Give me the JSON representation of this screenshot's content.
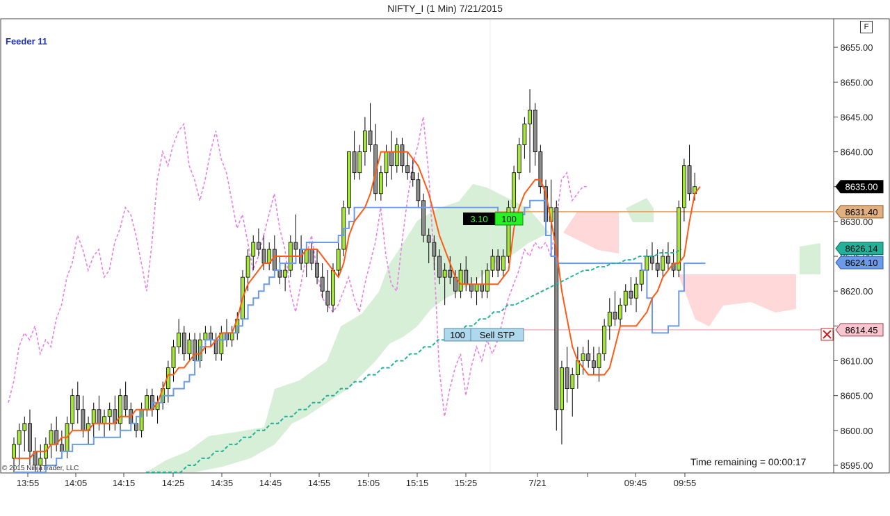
{
  "window": {
    "title": "NIFTY_I (1 Min)  7/21/2015"
  },
  "feeder": {
    "label": "Feeder 11"
  },
  "toolbar": {
    "f_button": "F"
  },
  "status": {
    "time_remaining": "Time remaining = 00:00:17",
    "copyright": "© 2015 NinjaTrader, LLC"
  },
  "orders": {
    "position": {
      "pnl": "3.10",
      "qty": "100"
    },
    "stop": {
      "qty": "100",
      "label": "Sell STP"
    }
  },
  "colors": {
    "candle_up": "#a6e63c",
    "candle_down": "#8c8c8c",
    "fast_line": "#ff5a14",
    "slow_line": "#6a9ae8",
    "dashed_teal": "#25b09b",
    "lagging_pink": "#e87ee8",
    "cloud_green": "#c9e8c9",
    "cloud_red": "#ffd0d0",
    "position_line": "#e8a060",
    "stop_line": "#f0b4c0"
  },
  "chart_data": {
    "type": "candlestick",
    "title": "NIFTY_I (1 Min)  7/21/2015",
    "ylim": [
      8594,
      8659
    ],
    "y_ticks": [
      8595,
      8600,
      8605,
      8610,
      8615,
      8620,
      8625,
      8630,
      8635,
      8640,
      8645,
      8650,
      8655
    ],
    "x_ticks": [
      "13:55",
      "14:05",
      "14:15",
      "14:25",
      "14:35",
      "14:45",
      "14:55",
      "15:05",
      "15:15",
      "15:25",
      "7/21",
      "09:45",
      "09:55"
    ],
    "price_markers": [
      {
        "label": "8635.00",
        "value": 8635.0,
        "kind": "last"
      },
      {
        "label": "8631.40",
        "value": 8631.4,
        "kind": "position"
      },
      {
        "label": "8626.14",
        "value": 8626.14,
        "kind": "teal"
      },
      {
        "label": "8624.10",
        "value": 8624.1,
        "kind": "slow"
      },
      {
        "label": "8614.45",
        "value": 8614.45,
        "kind": "stop"
      }
    ],
    "position_price": 8631.4,
    "stop_price": 8614.45,
    "candles": [
      [
        8596.0,
        8599.0,
        8594.0,
        8598.0
      ],
      [
        8598.0,
        8601.0,
        8595.0,
        8600.0
      ],
      [
        8600.0,
        8602.0,
        8597.0,
        8601.0
      ],
      [
        8601.0,
        8603.0,
        8595.0,
        8597.0
      ],
      [
        8597.0,
        8599.0,
        8594.0,
        8595.0
      ],
      [
        8595.0,
        8598.0,
        8594.0,
        8596.0
      ],
      [
        8596.0,
        8599.0,
        8595.0,
        8598.0
      ],
      [
        8598.0,
        8601.0,
        8596.0,
        8600.0
      ],
      [
        8600.0,
        8602.0,
        8597.0,
        8598.0
      ],
      [
        8598.0,
        8600.0,
        8596.0,
        8597.0
      ],
      [
        8597.0,
        8602.0,
        8596.0,
        8601.0
      ],
      [
        8601.0,
        8606.0,
        8600.0,
        8605.0
      ],
      [
        8605.0,
        8607.0,
        8601.0,
        8603.0
      ],
      [
        8603.0,
        8605.0,
        8599.0,
        8600.0
      ],
      [
        8600.0,
        8602.0,
        8598.0,
        8601.0
      ],
      [
        8601.0,
        8604.0,
        8599.0,
        8603.0
      ],
      [
        8603.0,
        8605.0,
        8600.0,
        8601.0
      ],
      [
        8601.0,
        8603.0,
        8599.0,
        8602.0
      ],
      [
        8602.0,
        8604.0,
        8600.0,
        8603.0
      ],
      [
        8603.0,
        8605.0,
        8600.0,
        8601.0
      ],
      [
        8601.0,
        8606.0,
        8600.0,
        8605.0
      ],
      [
        8605.0,
        8607.0,
        8602.0,
        8603.0
      ],
      [
        8603.0,
        8604.0,
        8600.0,
        8601.0
      ],
      [
        8601.0,
        8602.0,
        8599.0,
        8600.0
      ],
      [
        8600.0,
        8604.0,
        8599.0,
        8603.0
      ],
      [
        8603.0,
        8606.0,
        8602.0,
        8605.0
      ],
      [
        8605.0,
        8606.0,
        8602.0,
        8603.0
      ],
      [
        8603.0,
        8605.0,
        8601.0,
        8604.0
      ],
      [
        8604.0,
        8607.0,
        8603.0,
        8606.0
      ],
      [
        8606.0,
        8610.0,
        8604.0,
        8609.0
      ],
      [
        8609.0,
        8613.0,
        8607.0,
        8612.0
      ],
      [
        8612.0,
        8616.0,
        8611.0,
        8614.0
      ],
      [
        8614.0,
        8615.0,
        8610.0,
        8611.0
      ],
      [
        8611.0,
        8614.0,
        8610.0,
        8613.0
      ],
      [
        8613.0,
        8614.0,
        8609.0,
        8610.0
      ],
      [
        8610.0,
        8614.0,
        8609.0,
        8613.0
      ],
      [
        8613.0,
        8615.0,
        8611.0,
        8614.0
      ],
      [
        8614.0,
        8615.0,
        8612.0,
        8613.0
      ],
      [
        8613.0,
        8614.0,
        8610.0,
        8611.0
      ],
      [
        8611.0,
        8615.0,
        8610.0,
        8614.0
      ],
      [
        8614.0,
        8616.0,
        8612.0,
        8613.0
      ],
      [
        8613.0,
        8615.0,
        8612.0,
        8614.0
      ],
      [
        8614.0,
        8617.0,
        8613.0,
        8616.0
      ],
      [
        8616.0,
        8623.0,
        8615.0,
        8622.0
      ],
      [
        8622.0,
        8626.0,
        8620.0,
        8625.0
      ],
      [
        8625.0,
        8628.0,
        8623.0,
        8627.0
      ],
      [
        8627.0,
        8629.0,
        8625.0,
        8626.0
      ],
      [
        8626.0,
        8628.0,
        8623.0,
        8624.0
      ],
      [
        8624.0,
        8627.0,
        8623.0,
        8626.0
      ],
      [
        8626.0,
        8628.0,
        8622.0,
        8623.0
      ],
      [
        8623.0,
        8625.0,
        8621.0,
        8622.0
      ],
      [
        8622.0,
        8624.0,
        8620.0,
        8623.0
      ],
      [
        8623.0,
        8628.0,
        8622.0,
        8627.0
      ],
      [
        8627.0,
        8631.0,
        8625.0,
        8626.0
      ],
      [
        8626.0,
        8628.0,
        8623.0,
        8624.0
      ],
      [
        8624.0,
        8627.0,
        8622.0,
        8626.0
      ],
      [
        8626.0,
        8627.0,
        8623.0,
        8624.0
      ],
      [
        8624.0,
        8626.0,
        8621.0,
        8622.0
      ],
      [
        8622.0,
        8624.0,
        8619.0,
        8620.0
      ],
      [
        8620.0,
        8623.0,
        8617.0,
        8618.0
      ],
      [
        8618.0,
        8624.0,
        8617.0,
        8623.0
      ],
      [
        8623.0,
        8627.0,
        8622.0,
        8626.0
      ],
      [
        8626.0,
        8633.0,
        8625.0,
        8632.0
      ],
      [
        8632.0,
        8640.0,
        8631.0,
        8640.0
      ],
      [
        8640.0,
        8643.0,
        8636.0,
        8637.0
      ],
      [
        8637.0,
        8641.0,
        8636.0,
        8640.0
      ],
      [
        8640.0,
        8645.0,
        8638.0,
        8643.0
      ],
      [
        8643.0,
        8647.0,
        8640.0,
        8641.0
      ],
      [
        8641.0,
        8644.0,
        8633.0,
        8634.0
      ],
      [
        8634.0,
        8638.0,
        8633.0,
        8637.0
      ],
      [
        8637.0,
        8641.0,
        8635.0,
        8640.0
      ],
      [
        8640.0,
        8643.0,
        8636.0,
        8638.0
      ],
      [
        8638.0,
        8642.0,
        8637.0,
        8641.0
      ],
      [
        8641.0,
        8642.0,
        8637.0,
        8638.0
      ],
      [
        8638.0,
        8640.0,
        8636.0,
        8637.0
      ],
      [
        8637.0,
        8639.0,
        8635.0,
        8636.0
      ],
      [
        8636.0,
        8637.0,
        8632.0,
        8633.0
      ],
      [
        8633.0,
        8634.0,
        8627.0,
        8628.0
      ],
      [
        8628.0,
        8629.0,
        8624.0,
        8627.0
      ],
      [
        8627.0,
        8628.0,
        8623.0,
        8625.0
      ],
      [
        8625.0,
        8626.0,
        8621.0,
        8622.0
      ],
      [
        8622.0,
        8624.0,
        8618.0,
        8623.0
      ],
      [
        8623.0,
        8625.0,
        8621.0,
        8622.0
      ],
      [
        8622.0,
        8623.0,
        8619.0,
        8620.0
      ],
      [
        8620.0,
        8624.0,
        8619.0,
        8623.0
      ],
      [
        8623.0,
        8625.0,
        8620.0,
        8621.0
      ],
      [
        8621.0,
        8622.0,
        8619.0,
        8620.0
      ],
      [
        8620.0,
        8622.0,
        8618.0,
        8621.0
      ],
      [
        8621.0,
        8623.0,
        8619.0,
        8620.0
      ],
      [
        8620.0,
        8624.0,
        8619.0,
        8623.0
      ],
      [
        8623.0,
        8626.0,
        8622.0,
        8625.0
      ],
      [
        8625.0,
        8626.0,
        8622.0,
        8623.0
      ],
      [
        8623.0,
        8626.0,
        8622.0,
        8625.0
      ],
      [
        8625.0,
        8633.0,
        8624.0,
        8632.0
      ],
      [
        8632.0,
        8638.0,
        8630.0,
        8637.0
      ],
      [
        8637.0,
        8642.0,
        8636.0,
        8641.0
      ],
      [
        8641.0,
        8645.0,
        8639.0,
        8644.0
      ],
      [
        8644.0,
        8649.0,
        8637.0,
        8646.0
      ],
      [
        8646.0,
        8647.0,
        8638.0,
        8640.0
      ],
      [
        8640.0,
        8641.0,
        8634.0,
        8635.0
      ],
      [
        8635.0,
        8636.0,
        8629.0,
        8630.0
      ],
      [
        8630.0,
        8636.0,
        8627.0,
        8632.0
      ],
      [
        8632.0,
        8633.0,
        8600.0,
        8603.0
      ],
      [
        8603.0,
        8610.0,
        8598.0,
        8609.0
      ],
      [
        8609.0,
        8612.0,
        8604.0,
        8606.0
      ],
      [
        8606.0,
        8609.0,
        8602.0,
        8608.0
      ],
      [
        8608.0,
        8612.0,
        8606.0,
        8610.0
      ],
      [
        8610.0,
        8612.0,
        8608.0,
        8611.0
      ],
      [
        8611.0,
        8613.0,
        8609.0,
        8610.0
      ],
      [
        8610.0,
        8612.0,
        8608.0,
        8609.0
      ],
      [
        8609.0,
        8612.0,
        8607.0,
        8611.0
      ],
      [
        8611.0,
        8616.0,
        8610.0,
        8615.0
      ],
      [
        8615.0,
        8619.0,
        8613.0,
        8617.0
      ],
      [
        8617.0,
        8620.0,
        8615.0,
        8616.0
      ],
      [
        8616.0,
        8619.0,
        8615.0,
        8618.0
      ],
      [
        8618.0,
        8621.0,
        8617.0,
        8620.0
      ],
      [
        8620.0,
        8622.0,
        8618.0,
        8619.0
      ],
      [
        8619.0,
        8622.0,
        8617.0,
        8621.0
      ],
      [
        8621.0,
        8624.0,
        8620.0,
        8623.0
      ],
      [
        8623.0,
        8626.0,
        8622.0,
        8625.0
      ],
      [
        8625.0,
        8627.0,
        8623.0,
        8624.0
      ],
      [
        8624.0,
        8626.0,
        8622.0,
        8623.0
      ],
      [
        8623.0,
        8626.0,
        8622.0,
        8625.0
      ],
      [
        8625.0,
        8627.0,
        8623.0,
        8624.0
      ],
      [
        8624.0,
        8626.0,
        8622.0,
        8623.0
      ],
      [
        8623.0,
        8633.0,
        8622.0,
        8632.0
      ],
      [
        8632.0,
        8639.0,
        8630.0,
        8638.0
      ],
      [
        8638.0,
        8641.0,
        8633.0,
        8634.0
      ],
      [
        8634.0,
        8637.0,
        8633.0,
        8635.0
      ]
    ],
    "fast_line": [
      8596.0,
      8596.0,
      8596.0,
      8596.0,
      8597.0,
      8597.0,
      8597.0,
      8598.0,
      8598.0,
      8599.0,
      8599.0,
      8600.0,
      8600.0,
      8600.0,
      8600.0,
      8601.0,
      8601.0,
      8601.0,
      8601.0,
      8601.0,
      8602.0,
      8602.0,
      8602.0,
      8603.0,
      8603.0,
      8603.0,
      8603.0,
      8604.0,
      8606.0,
      8608.0,
      8608.0,
      8609.0,
      8609.0,
      8610.0,
      8611.0,
      8611.0,
      8612.0,
      8612.0,
      8613.0,
      8614.0,
      8614.0,
      8614.0,
      8616.0,
      8619.0,
      8621.0,
      8622.0,
      8623.0,
      8624.0,
      8624.0,
      8625.0,
      8625.0,
      8625.0,
      8625.0,
      8625.0,
      8625.0,
      8626.0,
      8626.0,
      8626.0,
      8625.0,
      8624.0,
      8623.0,
      8622.0,
      8624.0,
      8628.0,
      8630.0,
      8631.0,
      8632.0,
      8634.0,
      8637.0,
      8640.0,
      8640.0,
      8640.0,
      8640.0,
      8640.0,
      8640.0,
      8639.0,
      8638.0,
      8636.0,
      8634.0,
      8631.0,
      8628.0,
      8626.0,
      8624.0,
      8622.0,
      8621.0,
      8621.0,
      8621.0,
      8621.0,
      8621.0,
      8621.0,
      8621.0,
      8621.0,
      8622.0,
      8623.0,
      8629.0,
      8632.0,
      8634.0,
      8635.0,
      8636.0,
      8636.0,
      8634.0,
      8630.0,
      8626.0,
      8620.0,
      8616.0,
      8612.0,
      8610.0,
      8609.0,
      8608.0,
      8608.0,
      8608.0,
      8608.0,
      8609.0,
      8612.0,
      8615.0,
      8615.0,
      8615.0,
      8615.0,
      8616.0,
      8617.0,
      8619.0,
      8620.0,
      8622.0,
      8623.0,
      8624.0,
      8624.0,
      8625.0,
      8630.0,
      8634.0,
      8635.0
    ],
    "slow_line": [
      8594.0,
      8594.0,
      8594.0,
      8594.0,
      8594.0,
      8594.0,
      8595.0,
      8595.0,
      8596.0,
      8597.0,
      8597.0,
      8598.0,
      8598.0,
      8598.0,
      8598.0,
      8599.0,
      8599.0,
      8599.0,
      8599.0,
      8599.0,
      8600.0,
      8600.0,
      8601.0,
      8602.0,
      8603.0,
      8603.0,
      8604.0,
      8604.0,
      8605.0,
      8605.0,
      8606.0,
      8606.0,
      8607.0,
      8608.0,
      8610.0,
      8612.0,
      8613.0,
      8613.0,
      8613.0,
      8613.0,
      8614.0,
      8614.0,
      8615.0,
      8616.0,
      8618.0,
      8619.0,
      8620.0,
      8621.0,
      8622.0,
      8623.0,
      8624.0,
      8624.0,
      8624.0,
      8625.0,
      8626.0,
      8627.0,
      8627.0,
      8627.0,
      8627.0,
      8627.0,
      8627.0,
      8628.0,
      8629.0,
      8630.0,
      8632.0,
      8632.0,
      8632.0,
      8632.0,
      8632.0,
      8632.0,
      8632.0,
      8632.0,
      8632.0,
      8632.0,
      8632.0,
      8632.0,
      8632.0,
      8632.0,
      8632.0,
      8632.0,
      8632.0,
      8632.0,
      8632.0,
      8632.0,
      8632.0,
      8632.0,
      8632.0,
      8632.0,
      8632.0,
      8632.0,
      8632.0,
      8631.0,
      8631.0,
      8631.0,
      8631.0,
      8631.0,
      8632.0,
      8633.0,
      8633.0,
      8633.0,
      8628.0,
      8625.0,
      8624.0,
      8624.0,
      8624.0,
      8624.0,
      8624.0,
      8624.0,
      8624.0,
      8624.0,
      8624.0,
      8624.0,
      8624.0,
      8624.0,
      8624.0,
      8624.0,
      8624.0,
      8624.0,
      8623.0,
      8619.0,
      8614.0,
      8614.0,
      8614.0,
      8615.0,
      8615.0,
      8620.0,
      8624.0,
      8624.0,
      8624.0,
      8624.0
    ],
    "dashed_teal": [
      8592.0,
      8592.0,
      8593.0,
      8593.0,
      8594.0,
      8594.0,
      8595.0,
      8595.0,
      8596.0,
      8596.0,
      8597.0,
      8597.0,
      8598.0,
      8598.0,
      8599.0,
      8599.0,
      8600.0,
      8600.0,
      8601.0,
      8601.0,
      8602.0,
      8602.0,
      8603.0,
      8603.0,
      8604.0,
      8604.0,
      8605.0,
      8605.0,
      8606.0,
      8606.0,
      8607.0,
      8607.0,
      8608.0,
      8608.0,
      8609.0,
      8609.0,
      8610.0,
      8610.0,
      8611.0,
      8611.0,
      8612.0,
      8612.0,
      8613.0,
      8613.0,
      8614.0,
      8614.0,
      8615.0,
      8615.0,
      8616.0,
      8616.0,
      8617.0,
      8617.0,
      8618.0,
      8618.0,
      8618.5,
      8619.0,
      8619.5,
      8620.0,
      8620.5,
      8621.0,
      8621.5,
      8622.0,
      8622.5,
      8623.0,
      8623.0,
      8623.5,
      8623.5,
      8624.0,
      8624.0,
      8624.5,
      8624.5,
      8625.0,
      8625.0,
      8625.0,
      8625.5,
      8625.5,
      8625.5,
      8626.0
    ],
    "lagging_pink": [
      8604.0,
      8607.0,
      8612.0,
      8614.0,
      8613.0,
      8615.0,
      8611.0,
      8613.0,
      8612.0,
      8616.0,
      8618.0,
      8622.0,
      8624.0,
      8628.0,
      8626.0,
      8623.0,
      8625.0,
      8626.0,
      8622.0,
      8623.0,
      8627.0,
      8629.0,
      8632.0,
      8631.0,
      8628.0,
      8624.0,
      8620.0,
      8627.0,
      8636.0,
      8640.0,
      8638.0,
      8641.0,
      8643.0,
      8644.0,
      8638.0,
      8636.0,
      8633.0,
      8636.0,
      8640.0,
      8643.0,
      8639.0,
      8637.0,
      8633.0,
      8629.0,
      8631.0,
      8627.0,
      8623.0,
      8625.0,
      8628.0,
      8631.0,
      8634.0,
      8629.0,
      8626.0,
      8620.0,
      8617.0,
      8621.0,
      8625.0,
      8628.0,
      8623.0,
      8619.0,
      8618.0,
      8617.0,
      8618.0,
      8620.0,
      8622.0,
      8619.0,
      8617.0,
      8621.0,
      8624.0,
      8627.0,
      8632.0,
      8625.0,
      8621.0,
      8620.0,
      8627.0,
      8633.0,
      8638.0,
      8641.0,
      8645.0,
      8637.0,
      8625.0,
      8609.0,
      8602.0,
      8606.0,
      8609.0,
      8611.0,
      8605.0,
      8609.0,
      8612.0,
      8610.0,
      8613.0,
      8611.0,
      8613.0,
      8616.0,
      8619.0,
      8621.0,
      8623.0,
      8626.0,
      8625.0,
      8627.0,
      8626.0,
      8627.0,
      8625.0,
      8630.0,
      8636.0,
      8637.0,
      8633.0,
      8634.0,
      8635.0,
      8635.0
    ]
  }
}
